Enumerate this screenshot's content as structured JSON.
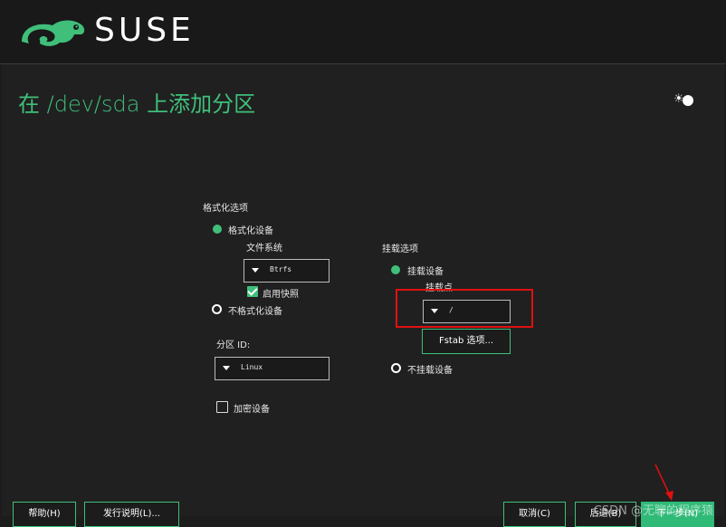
{
  "header": {
    "brand": "SUSE"
  },
  "page": {
    "title": "在 /dev/sda 上添加分区"
  },
  "format_options": {
    "section_label": "格式化选项",
    "format_device_label": "格式化设备",
    "filesystem_label": "文件系统",
    "filesystem_value": "Btrfs",
    "enable_snapshots_label": "启用快照",
    "no_format_label": "不格式化设备",
    "partition_id_label": "分区 ID:",
    "partition_id_value": "Linux",
    "encrypt_label": "加密设备"
  },
  "mount_options": {
    "section_label": "挂载选项",
    "mount_device_label": "挂载设备",
    "mount_point_label": "挂载点",
    "mount_point_value": "/",
    "fstab_button_label": "Fstab 选项...",
    "no_mount_label": "不挂载设备"
  },
  "footer": {
    "help_label": "帮助(H)",
    "release_notes_label": "发行说明(L)...",
    "cancel_label": "取消(C)",
    "back_label": "后退(B)",
    "next_label": "下一步(N)"
  },
  "watermark": "CSDN @无聊的程序猿",
  "colors": {
    "accent": "#30ba78",
    "title": "#3fbf7a",
    "highlight": "#e01010",
    "background": "#202020"
  }
}
